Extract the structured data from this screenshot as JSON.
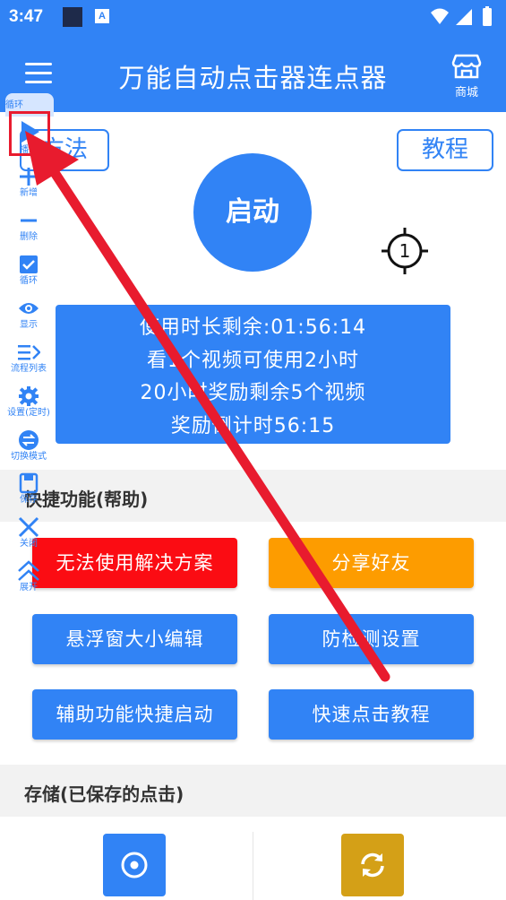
{
  "status": {
    "time": "3:47",
    "notif_icon_letter": "A"
  },
  "appbar": {
    "title": "万能自动点击器连点器",
    "store_label": "商城"
  },
  "top_buttons": {
    "method": "方法",
    "tutorial": "教程"
  },
  "start_button": "启动",
  "target": {
    "number": "1"
  },
  "info_box": {
    "line1": "使用时长剩余:01:56:14",
    "line2": "看1个视频可使用2小时",
    "line3": "20小时奖励剩余5个视频",
    "line4": "奖励倒计时56:15"
  },
  "shortcut_section": {
    "title": "快捷功能(帮助)"
  },
  "actions": {
    "cannot_use": "无法使用解决方案",
    "share": "分享好友",
    "float_size": "悬浮窗大小编辑",
    "anti_detect": "防检测设置",
    "accessibility": "辅助功能快捷启动",
    "quick_tutorial": "快速点击教程"
  },
  "storage_section": {
    "title": "存储(已保存的点击)"
  },
  "floatbar": {
    "top_label": "循环",
    "play_label": "播放",
    "add_label": "新增",
    "delete_label": "删除",
    "loop_label": "循环",
    "show_label": "显示",
    "process_label": "流程列表",
    "settings_label": "设置(定时)",
    "switch_label": "切换模式",
    "save_label": "保存",
    "close_label": "关闭",
    "expand_label": "展开"
  },
  "colors": {
    "primary": "#3183f5",
    "red": "#fb0c13",
    "orange": "#fd9c00",
    "gold": "#d4a017",
    "annotation_red": "#e81b2e"
  }
}
